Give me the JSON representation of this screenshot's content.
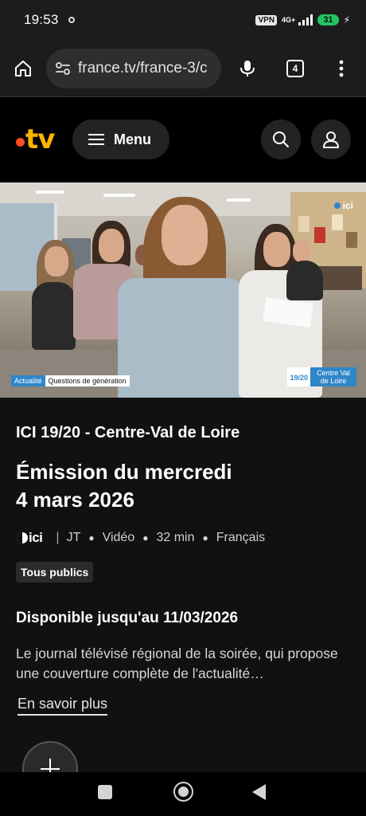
{
  "status_bar": {
    "time": "19:53",
    "vpn": "VPN",
    "network": "4G+",
    "battery": "31"
  },
  "browser": {
    "url": "france.tv/france-3/c",
    "tab_count": "4"
  },
  "site_header": {
    "logo_text": "tv",
    "menu_label": "Menu"
  },
  "video": {
    "lower_third_tag": "Actualité",
    "lower_third_label": "Questions de génération",
    "watermark": "ici",
    "channel_num": "19/20",
    "channel_region": "Centre Val de Loire"
  },
  "program": {
    "title": "ICI 19/20 - Centre-Val de Loire",
    "episode_title": "Émission du mercredi\n4 mars 2026",
    "meta": {
      "channel": "ici",
      "genre": "JT",
      "format": "Vidéo",
      "duration": "32 min",
      "language": "Français"
    },
    "audience_badge": "Tous publics",
    "availability": "Disponible jusqu'au 11/03/2026",
    "description": "Le journal télévisé régional de la soirée, qui propose une couverture complète de l'actualité…",
    "more_link": "En savoir plus"
  },
  "colors": {
    "background": "#000000",
    "info_background": "#111111",
    "accent_blue": "#2f86c9",
    "logo_yellow": "#ffb400",
    "logo_red": "#ff4b1f",
    "battery_green": "#22c55e"
  }
}
